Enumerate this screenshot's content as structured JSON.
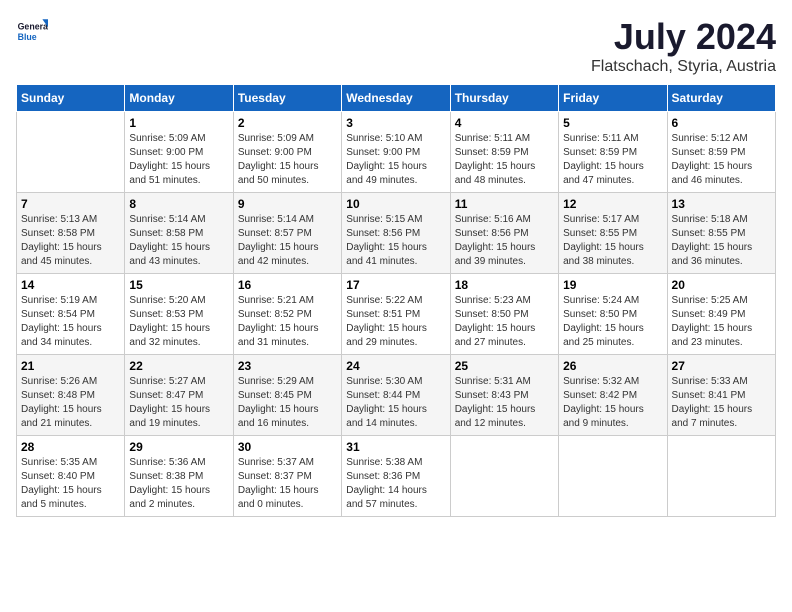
{
  "logo": {
    "line1": "General",
    "line2": "Blue"
  },
  "title": "July 2024",
  "subtitle": "Flatschach, Styria, Austria",
  "header": {
    "colors": {
      "accent": "#1565c0"
    }
  },
  "weekdays": [
    "Sunday",
    "Monday",
    "Tuesday",
    "Wednesday",
    "Thursday",
    "Friday",
    "Saturday"
  ],
  "weeks": [
    [
      {
        "day": "",
        "info": ""
      },
      {
        "day": "1",
        "info": "Sunrise: 5:09 AM\nSunset: 9:00 PM\nDaylight: 15 hours\nand 51 minutes."
      },
      {
        "day": "2",
        "info": "Sunrise: 5:09 AM\nSunset: 9:00 PM\nDaylight: 15 hours\nand 50 minutes."
      },
      {
        "day": "3",
        "info": "Sunrise: 5:10 AM\nSunset: 9:00 PM\nDaylight: 15 hours\nand 49 minutes."
      },
      {
        "day": "4",
        "info": "Sunrise: 5:11 AM\nSunset: 8:59 PM\nDaylight: 15 hours\nand 48 minutes."
      },
      {
        "day": "5",
        "info": "Sunrise: 5:11 AM\nSunset: 8:59 PM\nDaylight: 15 hours\nand 47 minutes."
      },
      {
        "day": "6",
        "info": "Sunrise: 5:12 AM\nSunset: 8:59 PM\nDaylight: 15 hours\nand 46 minutes."
      }
    ],
    [
      {
        "day": "7",
        "info": "Sunrise: 5:13 AM\nSunset: 8:58 PM\nDaylight: 15 hours\nand 45 minutes."
      },
      {
        "day": "8",
        "info": "Sunrise: 5:14 AM\nSunset: 8:58 PM\nDaylight: 15 hours\nand 43 minutes."
      },
      {
        "day": "9",
        "info": "Sunrise: 5:14 AM\nSunset: 8:57 PM\nDaylight: 15 hours\nand 42 minutes."
      },
      {
        "day": "10",
        "info": "Sunrise: 5:15 AM\nSunset: 8:56 PM\nDaylight: 15 hours\nand 41 minutes."
      },
      {
        "day": "11",
        "info": "Sunrise: 5:16 AM\nSunset: 8:56 PM\nDaylight: 15 hours\nand 39 minutes."
      },
      {
        "day": "12",
        "info": "Sunrise: 5:17 AM\nSunset: 8:55 PM\nDaylight: 15 hours\nand 38 minutes."
      },
      {
        "day": "13",
        "info": "Sunrise: 5:18 AM\nSunset: 8:55 PM\nDaylight: 15 hours\nand 36 minutes."
      }
    ],
    [
      {
        "day": "14",
        "info": "Sunrise: 5:19 AM\nSunset: 8:54 PM\nDaylight: 15 hours\nand 34 minutes."
      },
      {
        "day": "15",
        "info": "Sunrise: 5:20 AM\nSunset: 8:53 PM\nDaylight: 15 hours\nand 32 minutes."
      },
      {
        "day": "16",
        "info": "Sunrise: 5:21 AM\nSunset: 8:52 PM\nDaylight: 15 hours\nand 31 minutes."
      },
      {
        "day": "17",
        "info": "Sunrise: 5:22 AM\nSunset: 8:51 PM\nDaylight: 15 hours\nand 29 minutes."
      },
      {
        "day": "18",
        "info": "Sunrise: 5:23 AM\nSunset: 8:50 PM\nDaylight: 15 hours\nand 27 minutes."
      },
      {
        "day": "19",
        "info": "Sunrise: 5:24 AM\nSunset: 8:50 PM\nDaylight: 15 hours\nand 25 minutes."
      },
      {
        "day": "20",
        "info": "Sunrise: 5:25 AM\nSunset: 8:49 PM\nDaylight: 15 hours\nand 23 minutes."
      }
    ],
    [
      {
        "day": "21",
        "info": "Sunrise: 5:26 AM\nSunset: 8:48 PM\nDaylight: 15 hours\nand 21 minutes."
      },
      {
        "day": "22",
        "info": "Sunrise: 5:27 AM\nSunset: 8:47 PM\nDaylight: 15 hours\nand 19 minutes."
      },
      {
        "day": "23",
        "info": "Sunrise: 5:29 AM\nSunset: 8:45 PM\nDaylight: 15 hours\nand 16 minutes."
      },
      {
        "day": "24",
        "info": "Sunrise: 5:30 AM\nSunset: 8:44 PM\nDaylight: 15 hours\nand 14 minutes."
      },
      {
        "day": "25",
        "info": "Sunrise: 5:31 AM\nSunset: 8:43 PM\nDaylight: 15 hours\nand 12 minutes."
      },
      {
        "day": "26",
        "info": "Sunrise: 5:32 AM\nSunset: 8:42 PM\nDaylight: 15 hours\nand 9 minutes."
      },
      {
        "day": "27",
        "info": "Sunrise: 5:33 AM\nSunset: 8:41 PM\nDaylight: 15 hours\nand 7 minutes."
      }
    ],
    [
      {
        "day": "28",
        "info": "Sunrise: 5:35 AM\nSunset: 8:40 PM\nDaylight: 15 hours\nand 5 minutes."
      },
      {
        "day": "29",
        "info": "Sunrise: 5:36 AM\nSunset: 8:38 PM\nDaylight: 15 hours\nand 2 minutes."
      },
      {
        "day": "30",
        "info": "Sunrise: 5:37 AM\nSunset: 8:37 PM\nDaylight: 15 hours\nand 0 minutes."
      },
      {
        "day": "31",
        "info": "Sunrise: 5:38 AM\nSunset: 8:36 PM\nDaylight: 14 hours\nand 57 minutes."
      },
      {
        "day": "",
        "info": ""
      },
      {
        "day": "",
        "info": ""
      },
      {
        "day": "",
        "info": ""
      }
    ]
  ]
}
